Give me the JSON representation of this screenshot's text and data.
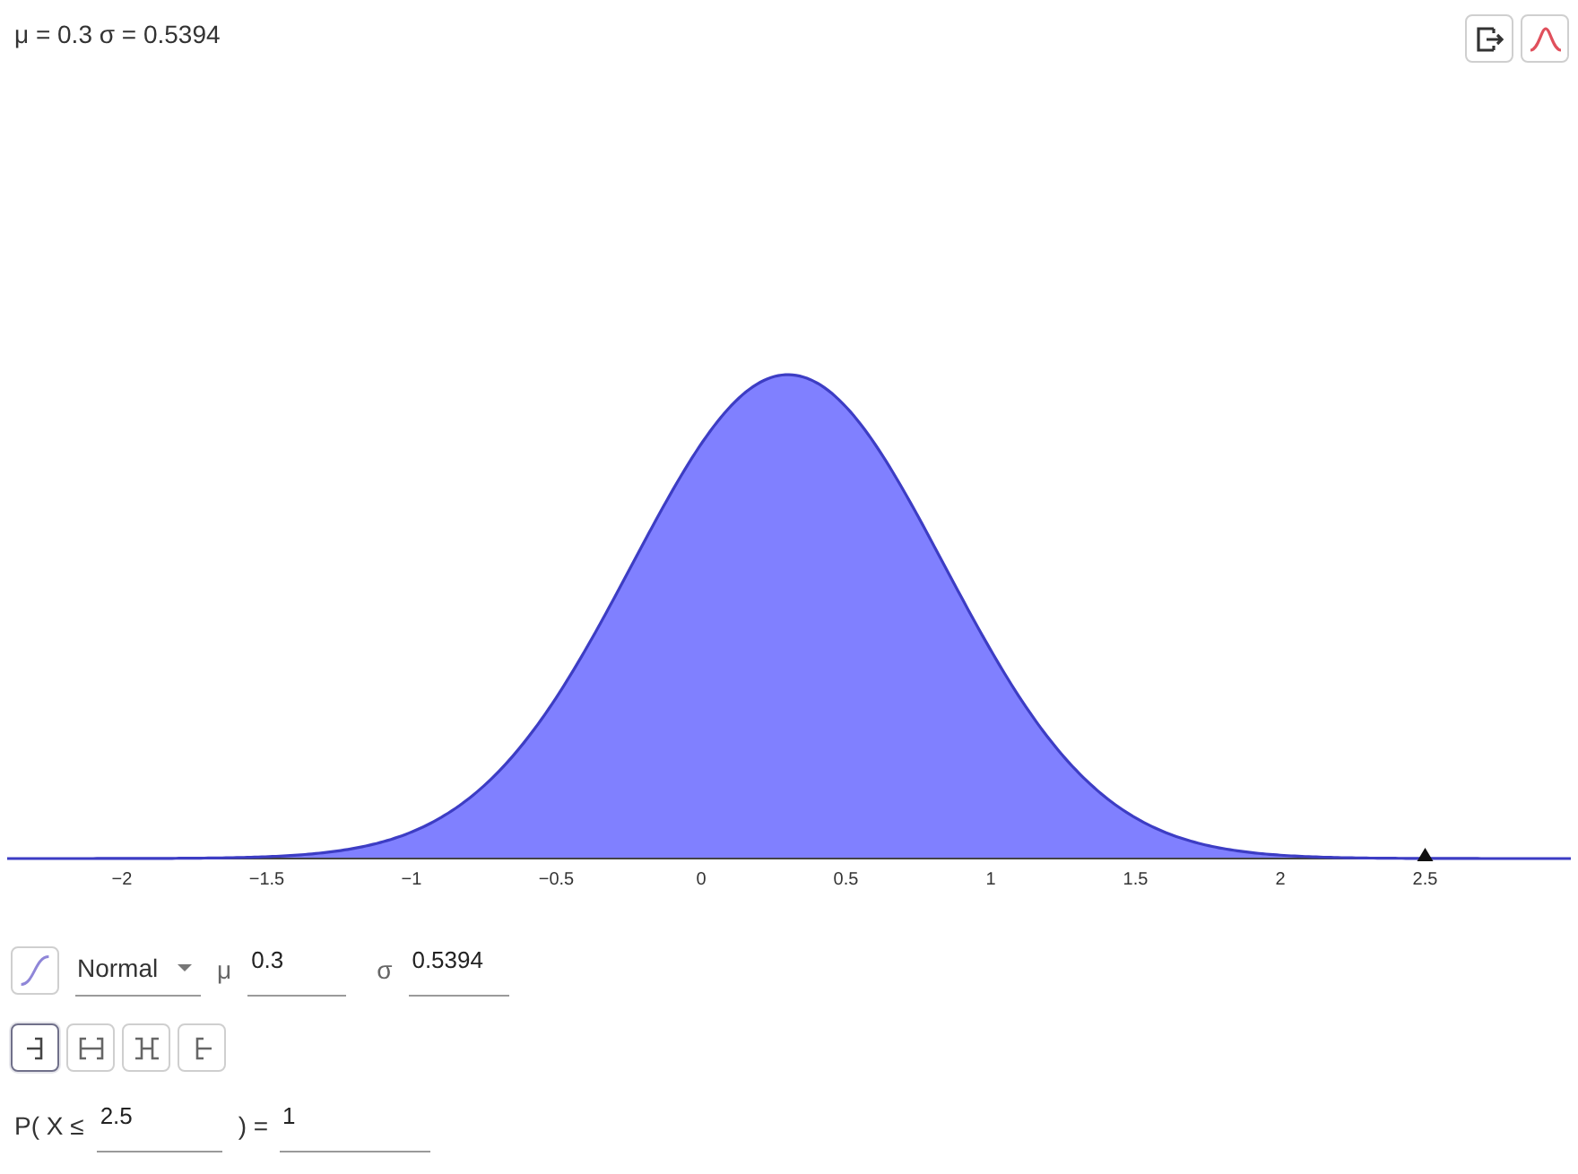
{
  "header": {
    "summary": "μ = 0.3 σ = 0.5394"
  },
  "plot": {
    "ticks": [
      "−2",
      "−1.5",
      "−1",
      "−0.5",
      "0",
      "0.5",
      "1",
      "1.5",
      "2",
      "2.5"
    ]
  },
  "distribution": {
    "name": "Normal",
    "params": [
      {
        "symbol": "μ",
        "value": "0.3"
      },
      {
        "symbol": "σ",
        "value": "0.5394"
      }
    ]
  },
  "intervals": [
    {
      "kind": "left",
      "selected": true
    },
    {
      "kind": "interval",
      "selected": false
    },
    {
      "kind": "two-tailed",
      "selected": false
    },
    {
      "kind": "right",
      "selected": false
    }
  ],
  "probability": {
    "prefix": "P( X ≤",
    "bound": "2.5",
    "equals": ") =",
    "result": "1"
  }
}
